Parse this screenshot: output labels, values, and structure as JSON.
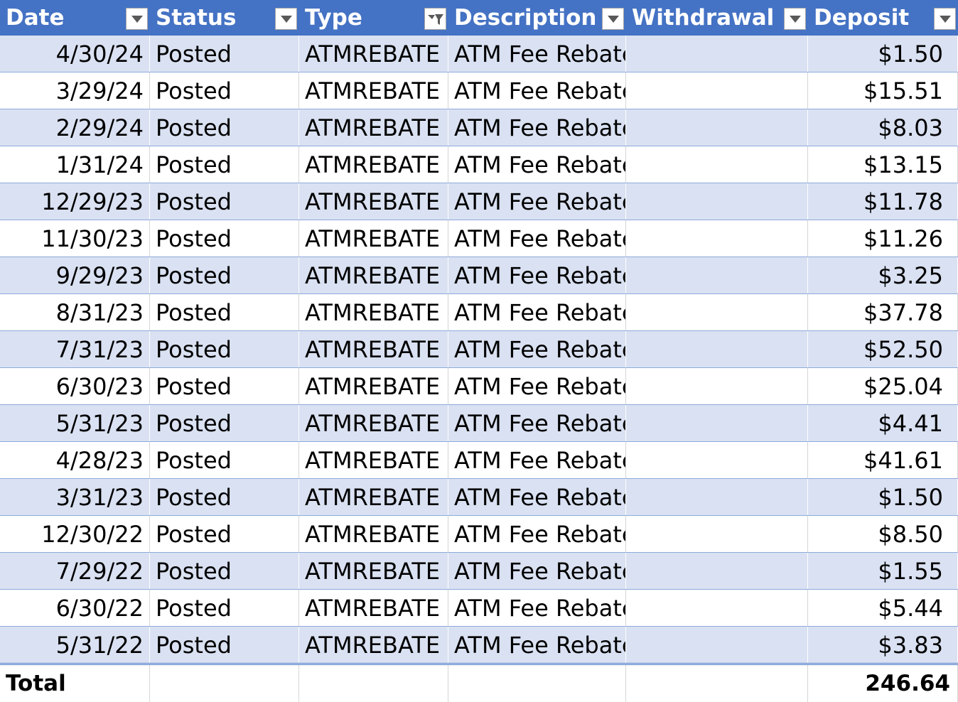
{
  "columns": [
    {
      "label": "Date",
      "filtered": false
    },
    {
      "label": "Status",
      "filtered": false
    },
    {
      "label": "Type",
      "filtered": true
    },
    {
      "label": "Description",
      "filtered": false
    },
    {
      "label": "Withdrawal",
      "filtered": false
    },
    {
      "label": "Deposit",
      "filtered": false
    }
  ],
  "rows": [
    {
      "date": "4/30/24",
      "status": "Posted",
      "type": "ATMREBATE",
      "description": "ATM Fee Rebate",
      "withdrawal": "",
      "deposit": "$1.50"
    },
    {
      "date": "3/29/24",
      "status": "Posted",
      "type": "ATMREBATE",
      "description": "ATM Fee Rebate",
      "withdrawal": "",
      "deposit": "$15.51"
    },
    {
      "date": "2/29/24",
      "status": "Posted",
      "type": "ATMREBATE",
      "description": "ATM Fee Rebate",
      "withdrawal": "",
      "deposit": "$8.03"
    },
    {
      "date": "1/31/24",
      "status": "Posted",
      "type": "ATMREBATE",
      "description": "ATM Fee Rebate",
      "withdrawal": "",
      "deposit": "$13.15"
    },
    {
      "date": "12/29/23",
      "status": "Posted",
      "type": "ATMREBATE",
      "description": "ATM Fee Rebate",
      "withdrawal": "",
      "deposit": "$11.78"
    },
    {
      "date": "11/30/23",
      "status": "Posted",
      "type": "ATMREBATE",
      "description": "ATM Fee Rebate",
      "withdrawal": "",
      "deposit": "$11.26"
    },
    {
      "date": "9/29/23",
      "status": "Posted",
      "type": "ATMREBATE",
      "description": "ATM Fee Rebate",
      "withdrawal": "",
      "deposit": "$3.25"
    },
    {
      "date": "8/31/23",
      "status": "Posted",
      "type": "ATMREBATE",
      "description": "ATM Fee Rebate",
      "withdrawal": "",
      "deposit": "$37.78"
    },
    {
      "date": "7/31/23",
      "status": "Posted",
      "type": "ATMREBATE",
      "description": "ATM Fee Rebate",
      "withdrawal": "",
      "deposit": "$52.50"
    },
    {
      "date": "6/30/23",
      "status": "Posted",
      "type": "ATMREBATE",
      "description": "ATM Fee Rebate",
      "withdrawal": "",
      "deposit": "$25.04"
    },
    {
      "date": "5/31/23",
      "status": "Posted",
      "type": "ATMREBATE",
      "description": "ATM Fee Rebate",
      "withdrawal": "",
      "deposit": "$4.41"
    },
    {
      "date": "4/28/23",
      "status": "Posted",
      "type": "ATMREBATE",
      "description": "ATM Fee Rebate",
      "withdrawal": "",
      "deposit": "$41.61"
    },
    {
      "date": "3/31/23",
      "status": "Posted",
      "type": "ATMREBATE",
      "description": "ATM Fee Rebate",
      "withdrawal": "",
      "deposit": "$1.50"
    },
    {
      "date": "12/30/22",
      "status": "Posted",
      "type": "ATMREBATE",
      "description": "ATM Fee Rebate",
      "withdrawal": "",
      "deposit": "$8.50"
    },
    {
      "date": "7/29/22",
      "status": "Posted",
      "type": "ATMREBATE",
      "description": "ATM Fee Rebate",
      "withdrawal": "",
      "deposit": "$1.55"
    },
    {
      "date": "6/30/22",
      "status": "Posted",
      "type": "ATMREBATE",
      "description": "ATM Fee Rebate",
      "withdrawal": "",
      "deposit": "$5.44"
    },
    {
      "date": "5/31/22",
      "status": "Posted",
      "type": "ATMREBATE",
      "description": "ATM Fee Rebate",
      "withdrawal": "",
      "deposit": "$3.83"
    }
  ],
  "total": {
    "label": "Total",
    "value": "246.64"
  },
  "colors": {
    "header_bg": "#4472c4",
    "band_bg": "#d9e1f2",
    "row_border": "#8eaadb"
  },
  "icons": {
    "dropdown": "chevron-down-icon",
    "active_filter": "filter-icon"
  }
}
